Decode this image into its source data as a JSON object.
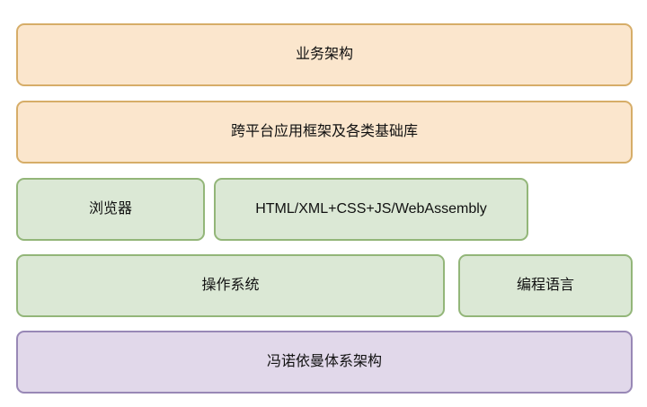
{
  "layers": {
    "business_architecture": "业务架构",
    "framework_and_libraries": "跨平台应用框架及各类基础库",
    "browser": "浏览器",
    "web_technologies": "HTML/XML+CSS+JS/WebAssembly",
    "operating_system": "操作系统",
    "programming_language": "编程语言",
    "von_neumann_architecture": "冯诺依曼体系架构"
  },
  "colors": {
    "orange_fill": "#fbe6cd",
    "orange_border": "#d6ad68",
    "green_fill": "#dbe8d5",
    "green_border": "#93b679",
    "purple_fill": "#e1d8ea",
    "purple_border": "#9888b6"
  }
}
